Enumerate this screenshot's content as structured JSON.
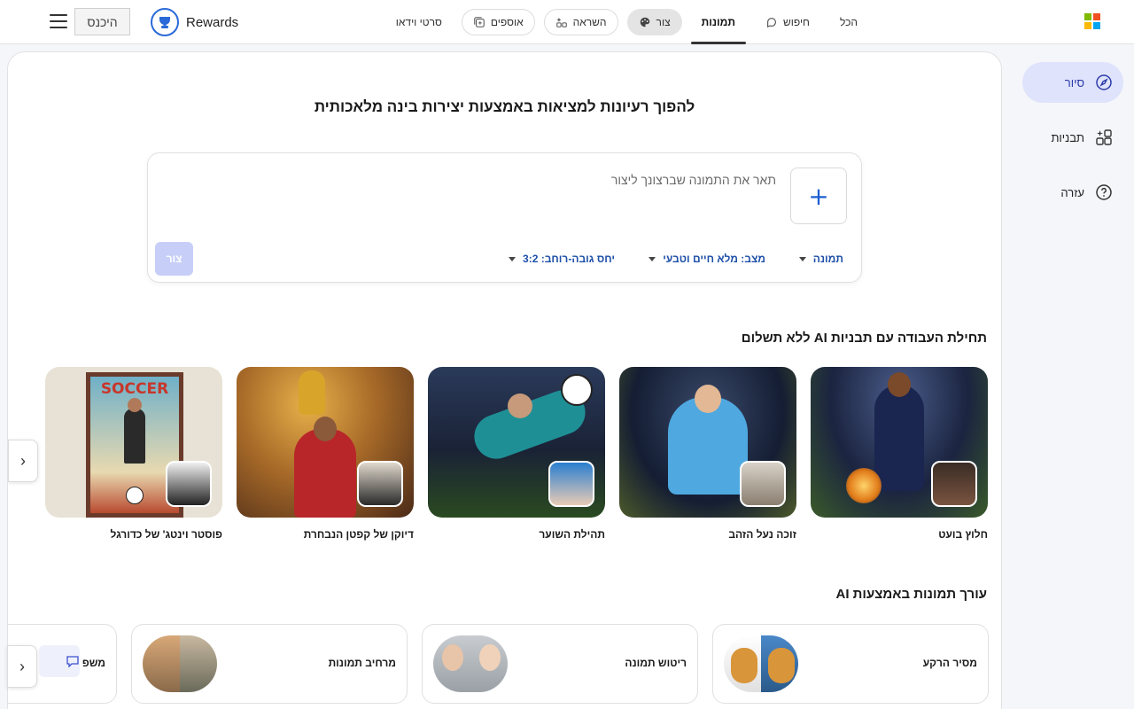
{
  "header": {
    "tabs": [
      {
        "label": "הכל",
        "icon": "",
        "style": "plain",
        "active": false
      },
      {
        "label": "חיפוש",
        "icon": "search-chat-icon",
        "style": "plain",
        "active": false
      },
      {
        "label": "תמונות",
        "icon": "",
        "style": "plain",
        "active": true
      },
      {
        "label": "צור",
        "icon": "palette-icon",
        "style": "pill-selected",
        "active": false
      },
      {
        "label": "השראה",
        "icon": "sparkle-grid-icon",
        "style": "pill",
        "active": false
      },
      {
        "label": "אוספים",
        "icon": "collections-icon",
        "style": "pill",
        "active": false
      },
      {
        "label": "סרטי וידאו",
        "icon": "",
        "style": "plain",
        "active": false
      }
    ],
    "brand": "Rewards",
    "login_label": "היכנס"
  },
  "sidebar": {
    "items": [
      {
        "label": "סיור",
        "icon": "compass-icon",
        "active": true
      },
      {
        "label": "תבניות",
        "icon": "templates-icon",
        "active": false
      },
      {
        "label": "עזרה",
        "icon": "help-icon",
        "active": false
      }
    ]
  },
  "main": {
    "headline": "להפוך רעיונות למציאות באמצעות יצירות בינה מלאכותית",
    "prompt": {
      "placeholder": "תאר את התמונה שברצונך ליצור",
      "add_label": "+",
      "options": [
        "תמונה",
        "מצב: מלא חיים וטבעי",
        "יחס גובה-רוחב: 3:2"
      ],
      "submit_label": "צור"
    },
    "templates_title": "תחילת העבודה עם תבניות AI ללא תשלום",
    "templates": [
      {
        "label": "חלוץ בועט"
      },
      {
        "label": "זוכה נעל הזהב"
      },
      {
        "label": "תהילת השוער"
      },
      {
        "label": "דיוקן של קפטן הנבחרת"
      },
      {
        "label": "פוסטר וינטג' של כדורגל",
        "poster_text": "SOCCER"
      }
    ],
    "tools_title": "עורך תמונות באמצעות AI",
    "tools": [
      {
        "label": "מסיר הרקע"
      },
      {
        "label": "ריטוש תמונה"
      },
      {
        "label": "מרחיב תמונות"
      },
      {
        "label": "משפ"
      }
    ],
    "arrow_label": "‹"
  },
  "colors": {
    "accent": "#1d4fa8",
    "sidebar_active_bg": "#dfe3fb",
    "submit_disabled": "#c7cef7",
    "ms_red": "#f25022",
    "ms_green": "#7fba00",
    "ms_blue": "#00a4ef",
    "ms_yellow": "#ffb900"
  }
}
